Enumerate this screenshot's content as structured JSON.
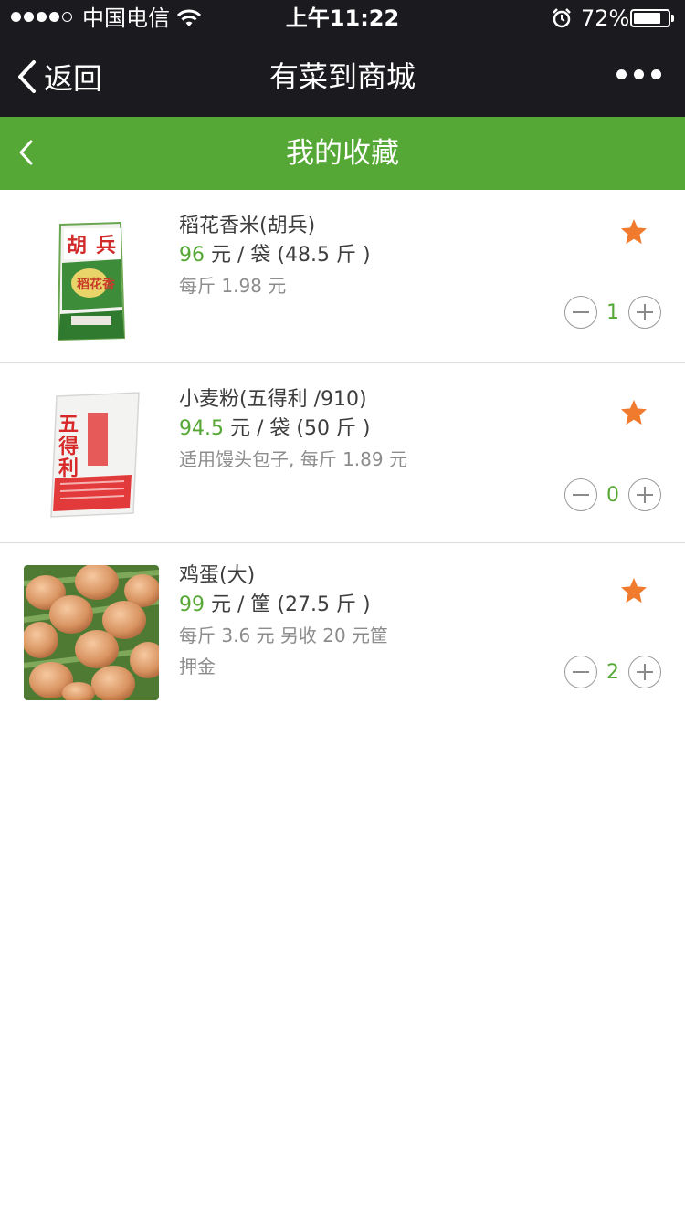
{
  "status_bar": {
    "carrier": "中国电信",
    "time": "上午11:22",
    "battery": "72%"
  },
  "nav": {
    "back_label": "返回",
    "title": "有菜到商城"
  },
  "page": {
    "title": "我的收藏"
  },
  "colors": {
    "brand_green": "#55a835",
    "star_orange": "#f07b2e"
  },
  "items": [
    {
      "name": "稻花香米(胡兵)",
      "price": "96",
      "unit": " 元 / 袋 (48.5 斤 )",
      "desc1": "每斤 1.98 元",
      "desc2": "",
      "quantity": "1",
      "favorited": true
    },
    {
      "name": "小麦粉(五得利 /910)",
      "price": "94.5",
      "unit": " 元 / 袋 (50 斤 )",
      "desc1": "适用馒头包子, 每斤 1.89 元",
      "desc2": "",
      "quantity": "0",
      "favorited": true
    },
    {
      "name": "鸡蛋(大)",
      "price": "99",
      "unit": " 元 / 筐 (27.5 斤 )",
      "desc1": "每斤 3.6 元 另收 20 元筐",
      "desc2": "押金",
      "quantity": "2",
      "favorited": true
    }
  ]
}
